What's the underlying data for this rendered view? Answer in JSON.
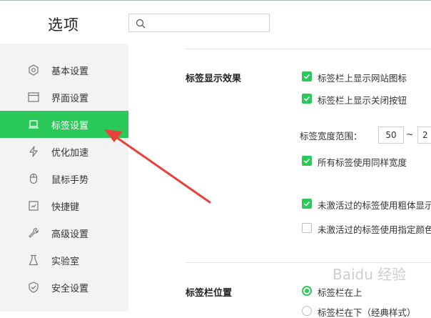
{
  "header": {
    "title": "选项",
    "search": {
      "value": "",
      "placeholder": ""
    }
  },
  "sidebar": {
    "items": [
      {
        "label": "基本设置",
        "icon": "hexagon-gear-icon",
        "active": false
      },
      {
        "label": "界面设置",
        "icon": "window-icon",
        "active": false
      },
      {
        "label": "标签设置",
        "icon": "laptop-tab-icon",
        "active": true
      },
      {
        "label": "优化加速",
        "icon": "lightning-icon",
        "active": false
      },
      {
        "label": "鼠标手势",
        "icon": "mouse-icon",
        "active": false
      },
      {
        "label": "快捷键",
        "icon": "keyboard-icon",
        "active": false
      },
      {
        "label": "高级设置",
        "icon": "wrench-icon",
        "active": false
      },
      {
        "label": "实验室",
        "icon": "flask-icon",
        "active": false
      },
      {
        "label": "安全设置",
        "icon": "shield-check-icon",
        "active": false
      }
    ]
  },
  "tab_display": {
    "title": "标签显示效果",
    "show_site_icon": {
      "label": "标签栏上显示网站图标",
      "checked": true
    },
    "show_close_button": {
      "label": "标签栏上显示关闭按钮",
      "checked": true
    },
    "width_range": {
      "label": "标签宽度范围：",
      "min": "50",
      "separator": "~",
      "max": "2"
    },
    "same_width": {
      "label": "所有标签使用同样宽度",
      "checked": true
    },
    "inactive_bold": {
      "label": "未激活过的标签使用粗体显示",
      "checked": true
    },
    "inactive_color": {
      "label": "未激活过的标签使用指定颜色",
      "checked": false
    }
  },
  "tab_bar_position": {
    "title": "标签栏位置",
    "top": {
      "label": "标签栏在上",
      "selected": true
    },
    "bottom": {
      "label": "标签栏在下（经典样式）",
      "selected": false
    }
  },
  "colors": {
    "accent": "#2ac95a",
    "sidebar_bg": "#f3f3f3"
  },
  "watermark": "Baidu 经验"
}
